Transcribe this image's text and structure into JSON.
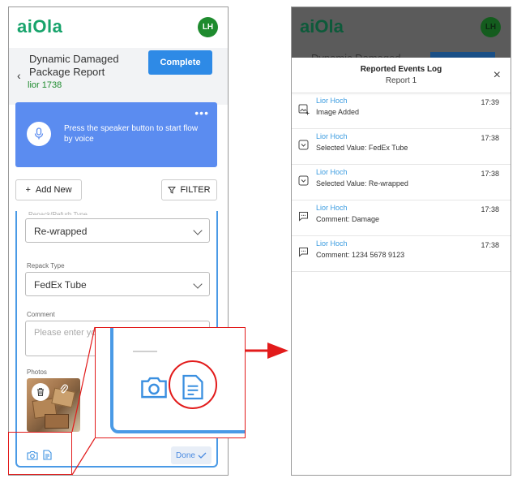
{
  "left": {
    "logo": "aiOla",
    "avatar": "LH",
    "title": "Dynamic Damaged Package Report",
    "subtitle": "lior 1738",
    "complete_label": "Complete",
    "voice_text": "Press the speaker button to start flow by voice",
    "more_label": "•••",
    "add_new_label": "Add New",
    "filter_label": "FILTER",
    "fields": {
      "cut_label": "Repack/Refurb Type",
      "first_value": "Re-wrapped",
      "repack_label": "Repack Type",
      "repack_value": "FedEx Tube",
      "comment_label": "Comment",
      "comment_placeholder": "Please enter your comment",
      "photos_label": "Photos"
    },
    "done_label": "Done"
  },
  "right": {
    "logo": "aiOla",
    "avatar": "LH",
    "dim_title": "Dynamic Damaged",
    "log": {
      "title": "Reported Events Log",
      "subtitle": "Report 1",
      "close": "×",
      "rows": [
        {
          "user": "Lior Hoch",
          "text": "Image Added",
          "time": "17:39",
          "icon": "image-add-icon"
        },
        {
          "user": "Lior Hoch",
          "text": "Selected Value: FedEx Tube",
          "time": "17:38",
          "icon": "dropdown-icon"
        },
        {
          "user": "Lior Hoch",
          "text": "Selected Value: Re-wrapped",
          "time": "17:38",
          "icon": "dropdown-icon"
        },
        {
          "user": "Lior Hoch",
          "text": "Comment: Damage",
          "time": "17:38",
          "icon": "comment-icon"
        },
        {
          "user": "Lior Hoch",
          "text": "Comment: 1234 5678 9123",
          "time": "17:38",
          "icon": "comment-icon"
        }
      ]
    }
  },
  "colors": {
    "brand_green": "#17a36b",
    "primary_blue": "#2e8ae6",
    "voice_card": "#5b8cf0",
    "callout_red": "#e21b1b",
    "link_blue": "#3a9be0"
  }
}
